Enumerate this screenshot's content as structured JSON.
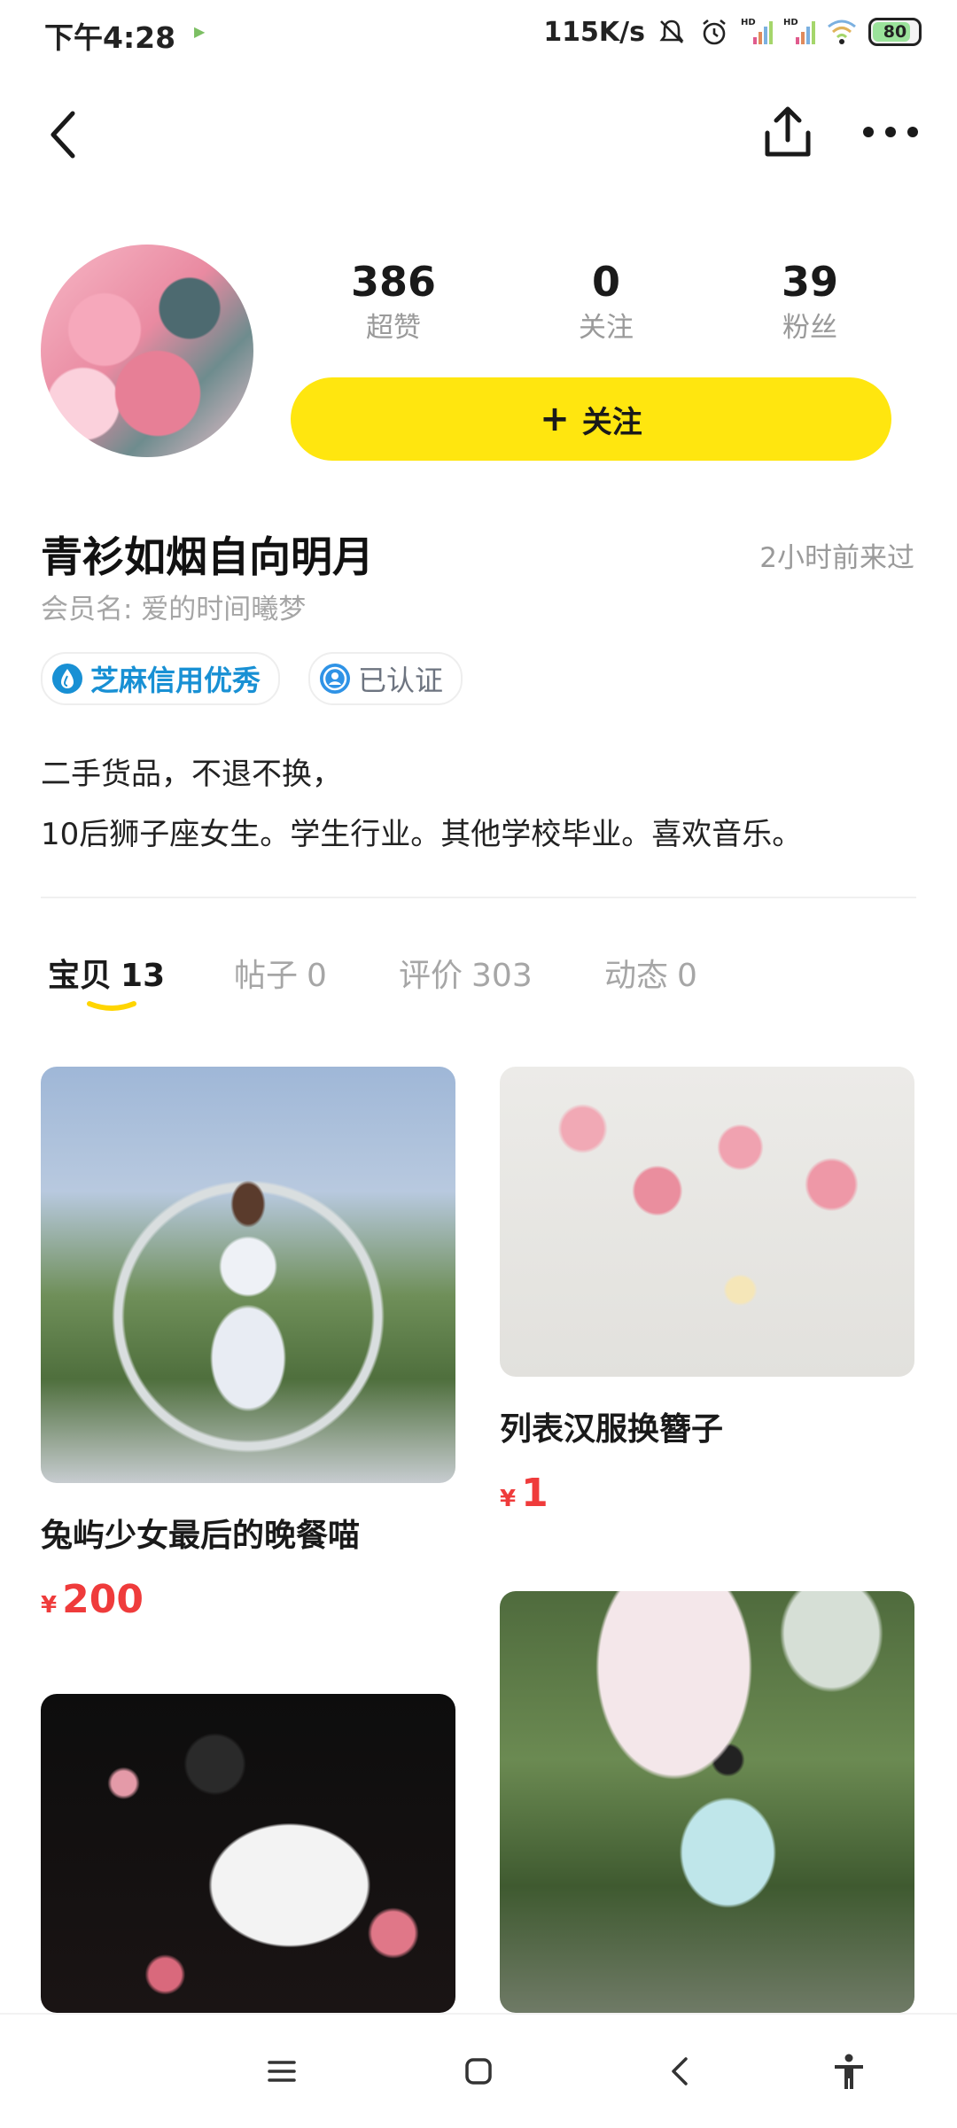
{
  "status_bar": {
    "time": "下午4:28",
    "network_speed": "115K/s",
    "battery": "80",
    "signal_label_1": "HD",
    "signal_label_2": "HD",
    "icons": [
      "mute-icon",
      "alarm-icon",
      "signal-icon",
      "signal-icon",
      "wifi-icon",
      "battery-icon"
    ]
  },
  "nav": {
    "back_icon": "back-arrow-icon",
    "share_icon": "share-icon",
    "more_icon": "more-dots-icon"
  },
  "profile": {
    "stats": [
      {
        "value": "386",
        "label": "超赞"
      },
      {
        "value": "0",
        "label": "关注"
      },
      {
        "value": "39",
        "label": "粉丝"
      }
    ],
    "follow_button": {
      "icon": "+",
      "label": "关注"
    },
    "name": "青衫如烟自向明月",
    "last_seen": "2小时前来过",
    "member_name": "会员名: 爱的时间曦梦",
    "badges": [
      {
        "label": "芝麻信用优秀",
        "icon": "sesame-credit-icon"
      },
      {
        "label": "已认证",
        "icon": "verified-icon"
      }
    ],
    "bio_lines": [
      "二手货品，不退不换，",
      "10后狮子座女生。学生行业。其他学校毕业。喜欢音乐。"
    ]
  },
  "tabs": [
    {
      "label": "宝贝",
      "count": "13",
      "active": true
    },
    {
      "label": "帖子",
      "count": "0",
      "active": false
    },
    {
      "label": "评价",
      "count": "303",
      "active": false
    },
    {
      "label": "动态",
      "count": "0",
      "active": false
    }
  ],
  "products": [
    {
      "title": "兔屿少女最后的晚餐喵",
      "currency": "¥",
      "price": "200"
    },
    {
      "title": "列表汉服换簪子",
      "currency": "¥",
      "price": "1"
    },
    {
      "title": "",
      "currency": "",
      "price": ""
    },
    {
      "title": "",
      "currency": "",
      "price": ""
    }
  ],
  "colors": {
    "accent_yellow": "#ffe60f",
    "price_red": "#ef3b3b",
    "credit_blue": "#1890d4",
    "muted_gray": "#9a9a9a"
  },
  "system_nav": {
    "icons": [
      "menu-icon",
      "home-icon",
      "back-icon",
      "accessibility-icon"
    ]
  }
}
